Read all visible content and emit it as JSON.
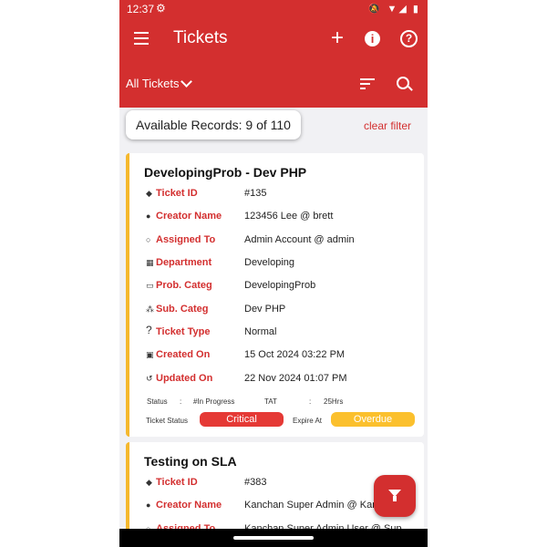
{
  "status": {
    "time": "12:37",
    "icons": "🔕 ▼◢ ▮"
  },
  "header": {
    "title": "Tickets",
    "filter_label": "All Tickets"
  },
  "records_text": "Available Records: 9 of 110",
  "clear_filter": "clear filter",
  "tickets": [
    {
      "title": "DevelopingProb - Dev PHP",
      "fields": [
        {
          "label": "Ticket ID",
          "value": "#135"
        },
        {
          "label": "Creator Name",
          "value": "123456 Lee @ brett"
        },
        {
          "label": "Assigned To",
          "value": "Admin Account @ admin"
        },
        {
          "label": "Department",
          "value": "Developing"
        },
        {
          "label": "Prob. Categ",
          "value": "DevelopingProb"
        },
        {
          "label": "Sub. Categ",
          "value": "Dev PHP"
        },
        {
          "label": "Ticket Type",
          "value": "Normal"
        },
        {
          "label": "Created On",
          "value": "15 Oct 2024 03:22 PM"
        },
        {
          "label": "Updated On",
          "value": "22 Nov 2024 01:07 PM"
        }
      ],
      "status_label": "Status",
      "status_value": "#In Progress",
      "tat_label": "TAT",
      "tat_value": "25Hrs",
      "ticket_status_label": "Ticket Status",
      "ticket_status_value": "Critical",
      "expire_label": "Expire At",
      "expire_value": "Overdue"
    },
    {
      "title": "Testing on SLA",
      "fields": [
        {
          "label": "Ticket ID",
          "value": "#383"
        },
        {
          "label": "Creator Name",
          "value": "Kanchan Super Admin @ Kanc"
        },
        {
          "label": "Assigned To",
          "value": "Kanchan Super Admin User @ Sup"
        }
      ]
    }
  ],
  "colors": {
    "brand": "#d32f2f",
    "accent": "#f5b82e",
    "critical": "#e53935",
    "overdue": "#fbc02d"
  }
}
